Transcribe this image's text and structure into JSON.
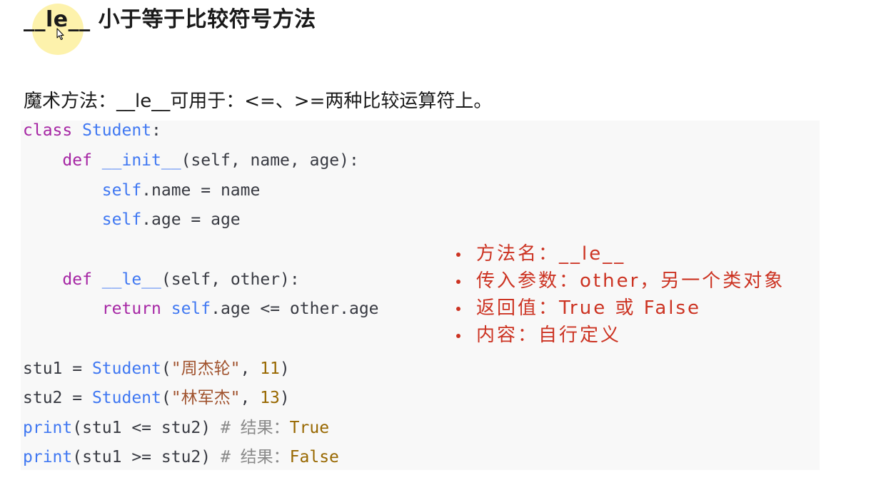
{
  "heading": "__le__ 小于等于比较符号方法",
  "description": "魔术方法：__le__可用于：<=、>=两种比较运算符上。",
  "code": {
    "class_kw": "class",
    "class_name": "Student",
    "colon": ":",
    "def_kw": "def",
    "init_name": "__init__",
    "init_params": "(self, name, age):",
    "self_kw": "self",
    "assign_name": ".name = name",
    "assign_age": ".age = age",
    "le_name": "__le__",
    "le_params": "(self, other):",
    "return_kw": "return",
    "return_expr": ".age <= other.age",
    "stu1_lhs": "stu1 = ",
    "stu2_lhs": "stu2 = ",
    "paren_open": "(",
    "stu1_str": "\"周杰轮\"",
    "stu2_str": "\"林军杰\"",
    "comma": ", ",
    "stu1_num": "11",
    "stu2_num": "13",
    "paren_close": ")",
    "print_kw": "print",
    "print1_args": "(stu1 <= stu2) ",
    "print2_args": "(stu1 >= stu2) ",
    "comment_prefix": "# 结果：",
    "result1": "True",
    "result2": "False"
  },
  "notes": [
    "方法名：__le__",
    "传入参数：other，另一个类对象",
    "返回值：True 或 False",
    "内容：自行定义"
  ],
  "colors": {
    "keyword": "#a626a4",
    "name": "#4078f2",
    "string": "#a0522d",
    "number": "#986801",
    "note": "#cc3322",
    "highlight": "#fdf09e"
  }
}
